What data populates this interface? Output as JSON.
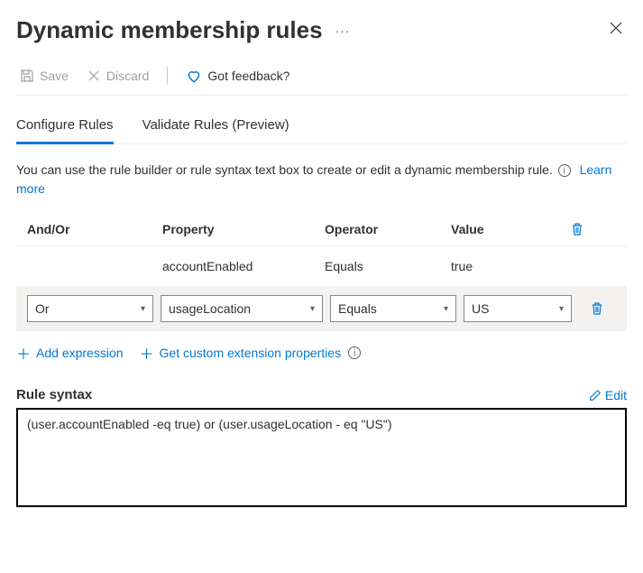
{
  "header": {
    "title": "Dynamic membership rules",
    "ellipsis": "···"
  },
  "toolbar": {
    "save_label": "Save",
    "discard_label": "Discard",
    "feedback_label": "Got feedback?"
  },
  "tabs": {
    "configure_label": "Configure Rules",
    "validate_label": "Validate Rules (Preview)"
  },
  "helper": {
    "text": "You can use the rule builder or rule syntax text box to create or edit a dynamic membership rule.",
    "learn_more": "Learn more"
  },
  "columns": {
    "andor": "And/Or",
    "property": "Property",
    "operator": "Operator",
    "value": "Value"
  },
  "rows": {
    "r1": {
      "andor": "",
      "property": "accountEnabled",
      "operator": "Equals",
      "value": "true"
    },
    "r2": {
      "andor": "Or",
      "property": "usageLocation",
      "operator": "Equals",
      "value": "US"
    }
  },
  "actions": {
    "add_expression": "Add expression",
    "get_custom": "Get custom extension properties"
  },
  "syntax": {
    "label": "Rule syntax",
    "edit_label": "Edit",
    "value": "(user.accountEnabled -eq true) or (user.usageLocation - eq \"US\")"
  }
}
